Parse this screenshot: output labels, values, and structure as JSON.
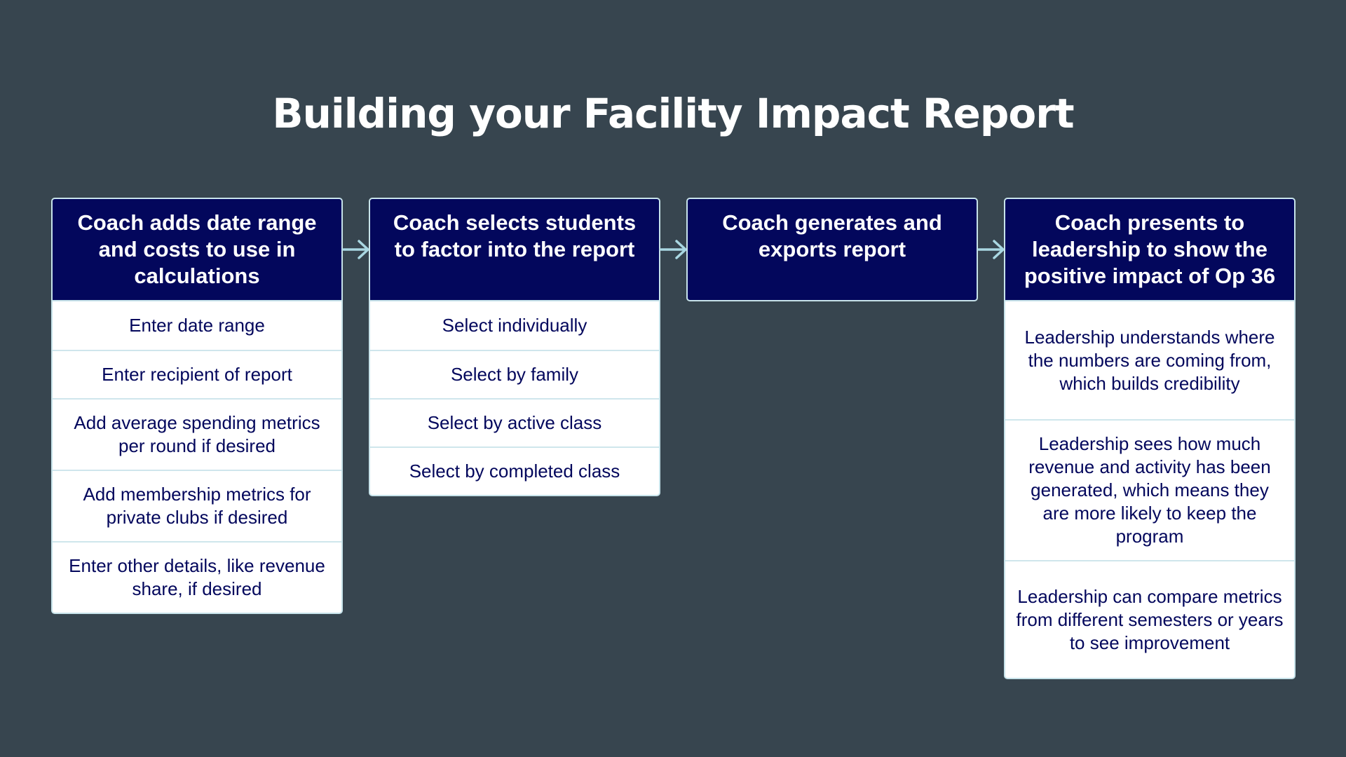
{
  "title": "Building your Facility Impact Report",
  "colors": {
    "background": "#37454f",
    "header_fill": "#03075c",
    "item_text": "#03075c",
    "border": "#c7e3ea",
    "arrow": "#a9d7e2"
  },
  "steps": [
    {
      "header": "Coach adds date range and costs to use in calculations",
      "items": [
        "Enter date range",
        "Enter recipient of report",
        "Add average spending metrics per round if desired",
        "Add membership metrics for private clubs if desired",
        "Enter other details, like revenue share, if desired"
      ]
    },
    {
      "header": "Coach selects students to factor into the report",
      "items": [
        "Select individually",
        "Select by family",
        "Select by active class",
        "Select by completed class"
      ]
    },
    {
      "header": "Coach generates and exports report",
      "items": []
    },
    {
      "header": "Coach presents to leadership to show the positive impact of Op 36",
      "items": [
        "Leadership understands where the numbers are coming from, which builds credibility",
        "Leadership sees how much revenue and activity has been generated, which means they are more likely to keep the program",
        "Leadership can compare metrics from different semesters or years to see improvement"
      ]
    }
  ],
  "connectors": [
    {
      "from": 0,
      "to": 1,
      "icon": "arrow-right-icon"
    },
    {
      "from": 1,
      "to": 2,
      "icon": "arrow-right-icon"
    },
    {
      "from": 2,
      "to": 3,
      "icon": "arrow-right-icon"
    }
  ]
}
